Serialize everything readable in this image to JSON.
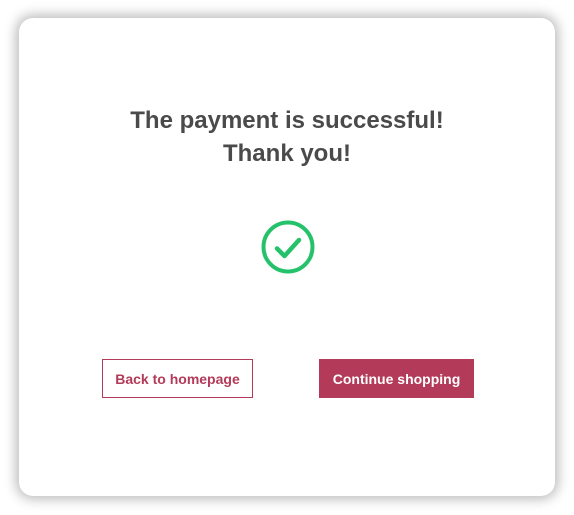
{
  "dialog": {
    "title_line1": "The payment is successful!",
    "title_line2": "Thank you!",
    "status_icon": "check-circle-icon",
    "icon_color": "#26c26b",
    "accent_color": "#b33a58"
  },
  "actions": {
    "back_label": "Back to homepage",
    "continue_label": "Continue shopping"
  }
}
